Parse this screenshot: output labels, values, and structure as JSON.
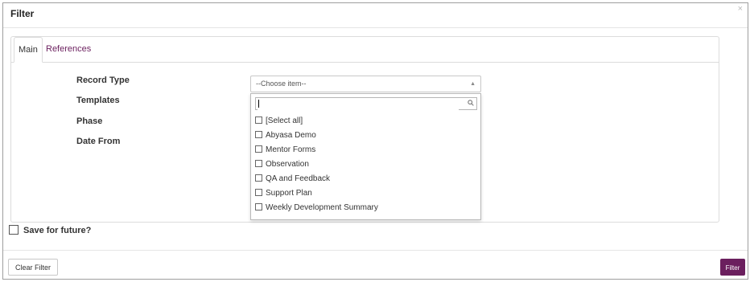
{
  "dialog": {
    "title": "Filter",
    "close_glyph": "×"
  },
  "tabs": [
    {
      "label": "Main",
      "active": true
    },
    {
      "label": "References",
      "active": false
    }
  ],
  "fields": {
    "record_type": "Record Type",
    "templates": "Templates",
    "phase": "Phase",
    "date_from": "Date From"
  },
  "select": {
    "value": "--Choose item--",
    "caret_glyph": "▲"
  },
  "dropdown": {
    "search_value": "",
    "search_icon": "magnifier-icon",
    "items": [
      "[Select all]",
      "Abyasa Demo",
      "Mentor Forms",
      "Observation",
      "QA and Feedback",
      "Support Plan",
      "Weekly Development Summary"
    ]
  },
  "save": {
    "label": "Save for future?",
    "checked": false
  },
  "buttons": {
    "clear": "Clear Filter",
    "filter": "Filter"
  },
  "colors": {
    "accent": "#6b1f5e",
    "border": "#dcdcdc"
  }
}
